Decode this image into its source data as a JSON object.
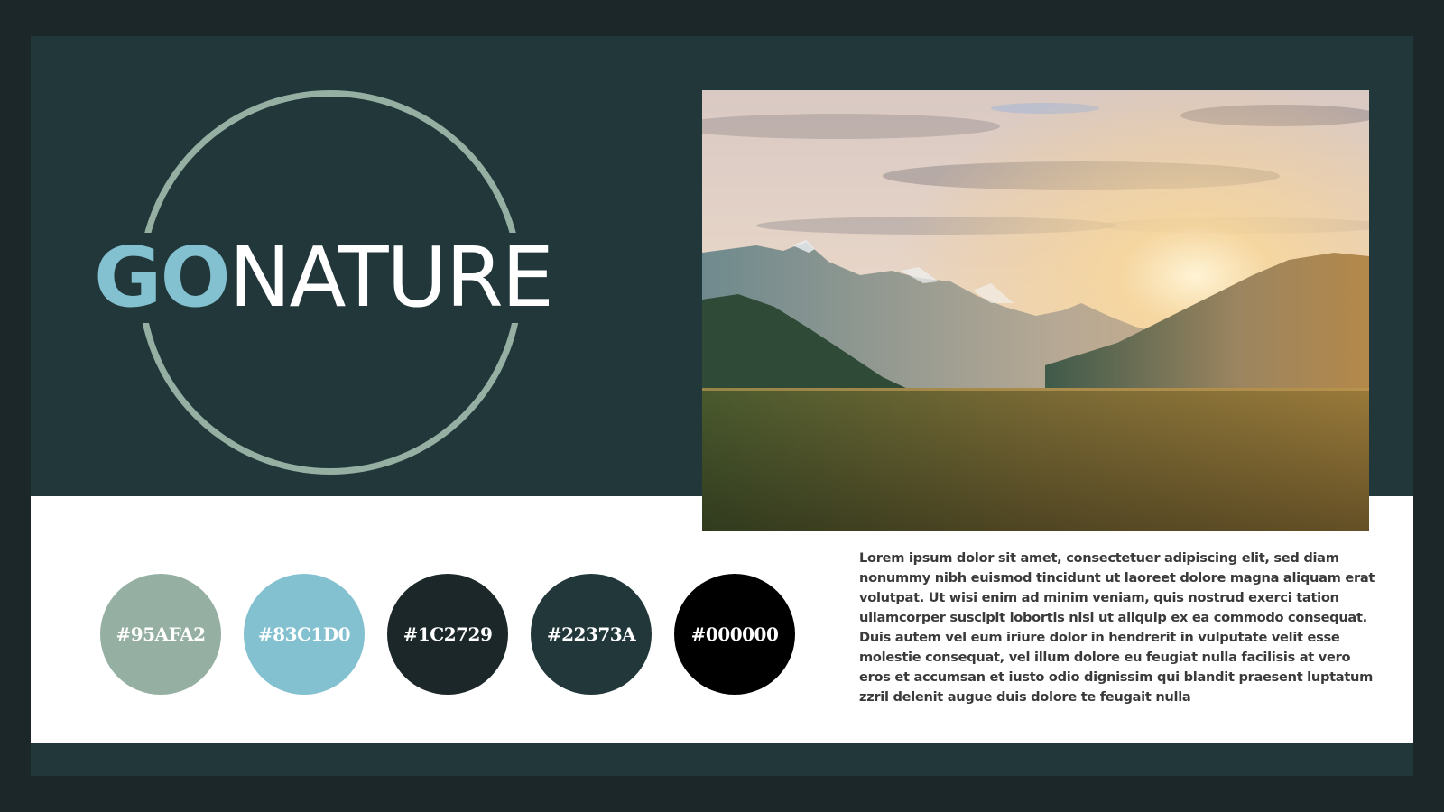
{
  "logo": {
    "part1": "GO",
    "part2": "NATURE",
    "colors": {
      "ring": "#95AFA2",
      "go": "#83C1D0",
      "nature": "#ffffff"
    }
  },
  "photo": {
    "subject": "mountain valley at sunset"
  },
  "palette": [
    {
      "label": "#95AFA2",
      "color": "#95AFA2"
    },
    {
      "label": "#83C1D0",
      "color": "#83C1D0"
    },
    {
      "label": "#1C2729",
      "color": "#1C2729"
    },
    {
      "label": "#22373A",
      "color": "#22373A"
    },
    {
      "label": "#000000",
      "color": "#000000"
    }
  ],
  "body_text": "Lorem ipsum dolor sit amet, consectetuer adipiscing elit, sed diam nonummy nibh euismod tincidunt ut laoreet dolore magna aliquam erat volutpat. Ut wisi enim ad minim veniam, quis nostrud exerci tation ullamcorper suscipit lobortis nisl ut aliquip ex ea commodo consequat. Duis autem vel eum iriure dolor in hendrerit in vulputate velit esse molestie consequat, vel illum dolore eu feugiat nulla facilisis at vero eros et accumsan et iusto odio dignissim qui blandit praesent luptatum zzril delenit augue duis dolore te feugait nulla",
  "theme": {
    "outer_background": "#1C2729",
    "panel_background": "#22373A",
    "band_background": "#ffffff",
    "text_color": "#3a3a3a"
  }
}
